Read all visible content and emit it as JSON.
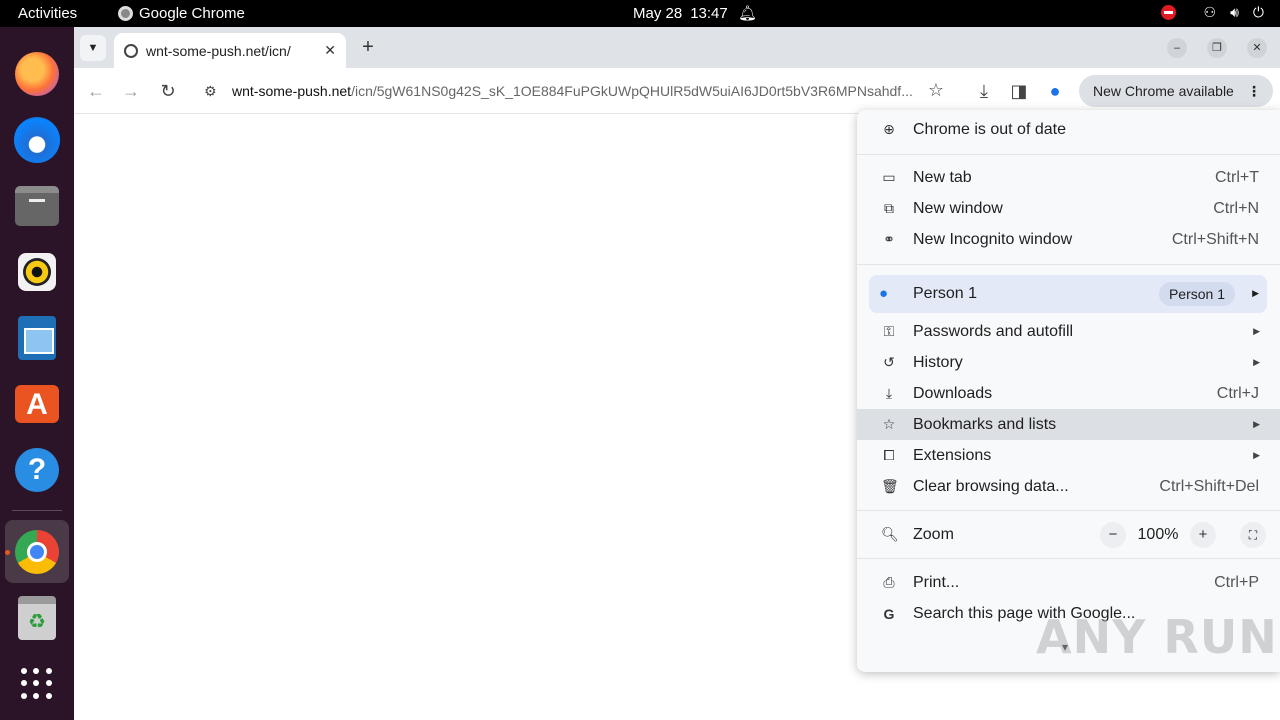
{
  "topbar": {
    "activities": "Activities",
    "app_name": "Google Chrome",
    "date": "May 28",
    "time": "13:47"
  },
  "dock": {
    "items": [
      "firefox-icon",
      "thunderbird-icon",
      "files-icon",
      "rhythmbox-icon",
      "libreoffice-writer-icon",
      "app-center-icon",
      "help-icon",
      "chrome-icon",
      "trash-icon",
      "show-apps-icon"
    ],
    "help_glyph": "?",
    "appstore_glyph": "A"
  },
  "browser": {
    "tab_title": "wnt-some-push.net/icn/",
    "tab_close": "✕",
    "new_tab": "+",
    "url_host": "wnt-some-push.net",
    "url_path": "/icn/5gW61NS0g42S_sK_1OE884FuPGkUWpQHUlR5dW5uiAI6JD0rt5bV3R6MPNsahdf...",
    "update_label": "New Chrome available",
    "update_dots": "⋮"
  },
  "menu": {
    "out_of_date": "Chrome is out of date",
    "new_tab": {
      "label": "New tab",
      "shortcut": "Ctrl+T"
    },
    "new_window": {
      "label": "New window",
      "shortcut": "Ctrl+N"
    },
    "incognito": {
      "label": "New Incognito window",
      "shortcut": "Ctrl+Shift+N"
    },
    "person": {
      "label": "Person 1",
      "chip": "Person 1"
    },
    "passwords": {
      "label": "Passwords and autofill"
    },
    "history": {
      "label": "History"
    },
    "downloads": {
      "label": "Downloads",
      "shortcut": "Ctrl+J"
    },
    "bookmarks": {
      "label": "Bookmarks and lists"
    },
    "extensions": {
      "label": "Extensions"
    },
    "clear": {
      "label": "Clear browsing data...",
      "shortcut": "Ctrl+Shift+Del"
    },
    "zoom": {
      "label": "Zoom",
      "value": "100%",
      "minus": "−",
      "plus": "+"
    },
    "print": {
      "label": "Print...",
      "shortcut": "Ctrl+P"
    },
    "search_page": {
      "label": "Search this page with Google..."
    }
  },
  "watermark": "ANY RUN"
}
